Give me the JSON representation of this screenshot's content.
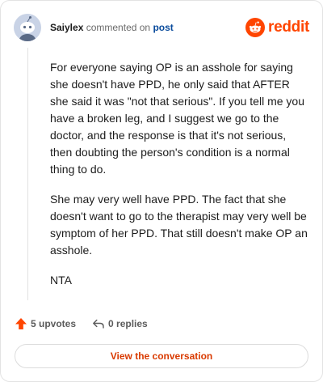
{
  "header": {
    "username": "Saiylex",
    "action_text": "commented on",
    "link_text": "post",
    "brand_name": "reddit",
    "brand_color": "#ff4500"
  },
  "comment": {
    "paragraphs": [
      "For everyone saying OP is an asshole for saying she doesn't have PPD, he only said that AFTER she said it was \"not that serious\". If you tell me you have a broken leg, and I suggest we go to the doctor, and the response is that it's not serious, then doubting the person's condition is a normal thing to do.",
      "She may very well have PPD. The fact that she doesn't want to go to the therapist may very well be symptom of her PPD. That still doesn't make OP an asshole.",
      "NTA"
    ]
  },
  "actions": {
    "upvotes_label": "5 upvotes",
    "replies_label": "0 replies",
    "upvote_icon": "upvote-arrow-icon",
    "reply_icon": "reply-arrow-icon",
    "upvote_color": "#ff4500"
  },
  "footer": {
    "view_label": "View the conversation",
    "link_color": "#d93a00"
  }
}
